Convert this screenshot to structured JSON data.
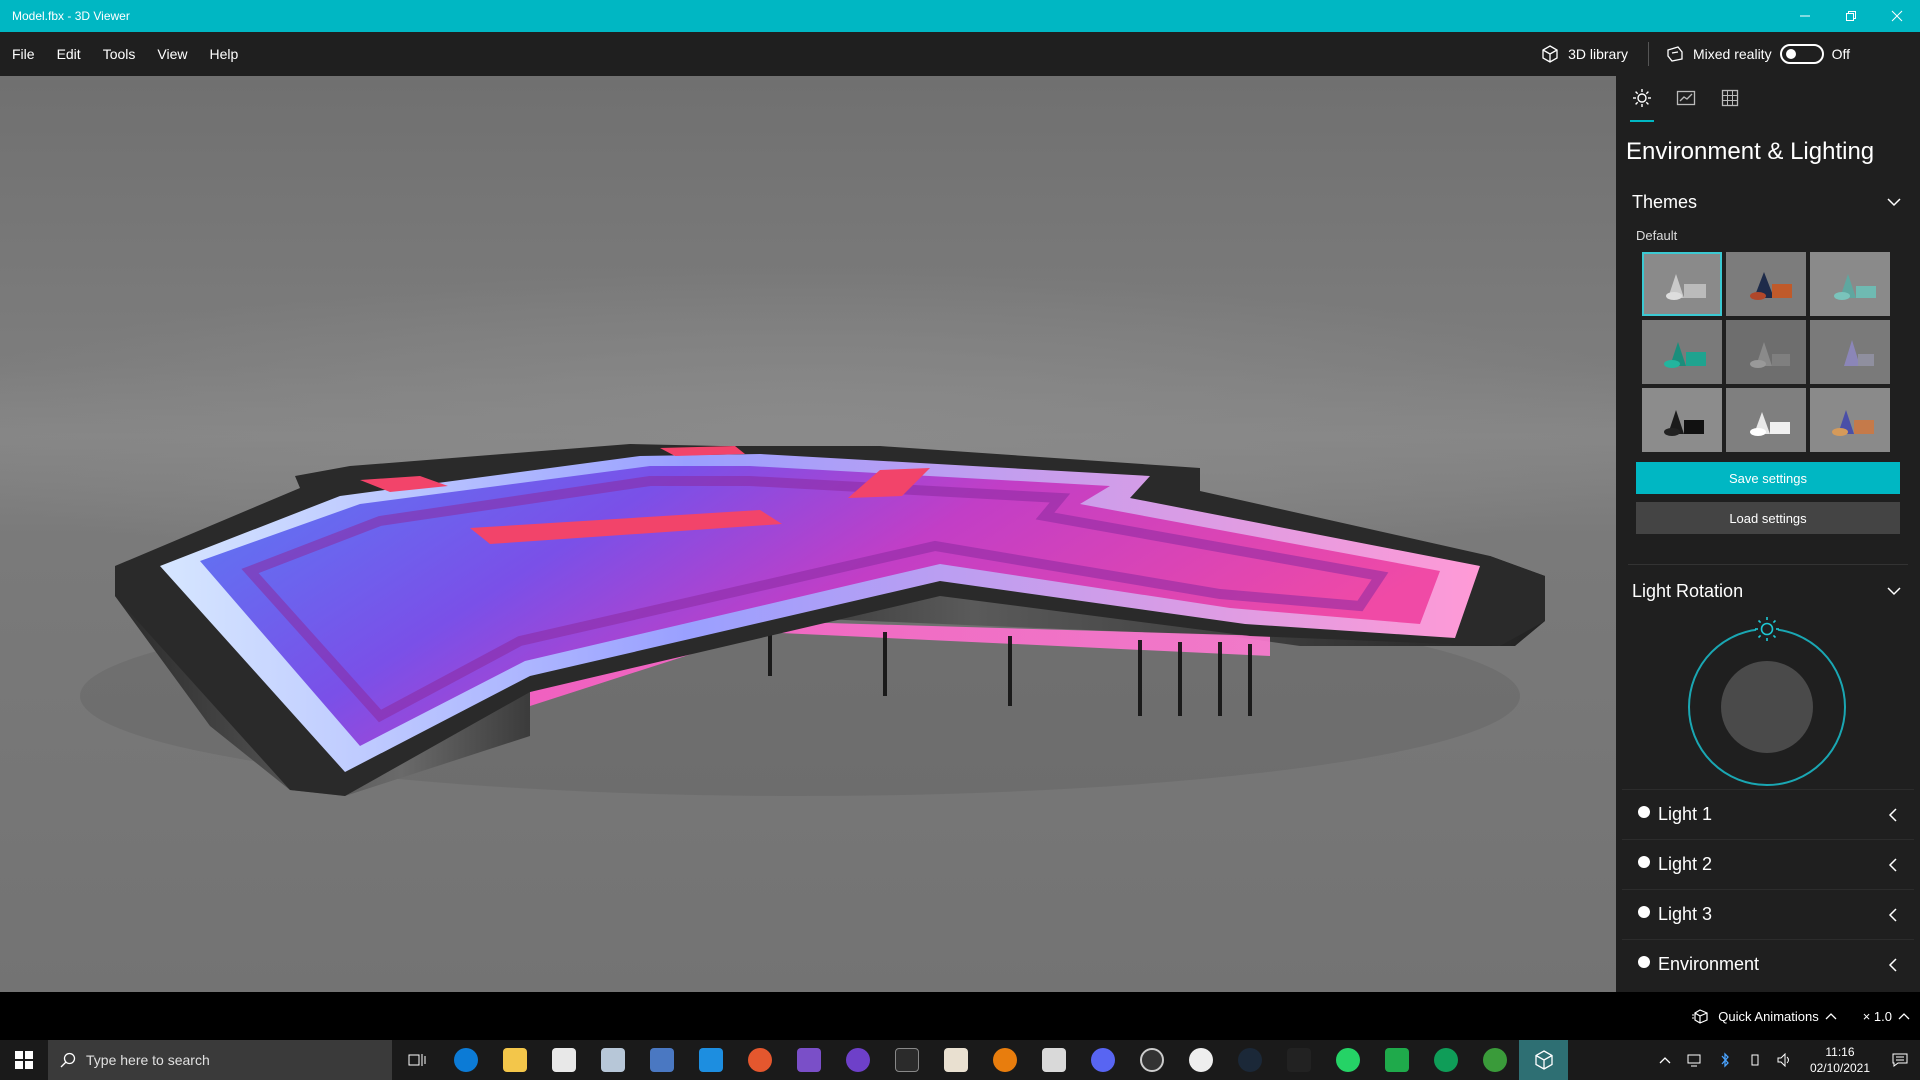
{
  "window": {
    "title": "Model.fbx - 3D Viewer"
  },
  "menu": {
    "items": [
      "File",
      "Edit",
      "Tools",
      "View",
      "Help"
    ],
    "library_label": "3D library",
    "mixed_reality_label": "Mixed reality",
    "mixed_reality_state": "Off"
  },
  "panel": {
    "title": "Environment & Lighting",
    "themes_label": "Themes",
    "default_label": "Default",
    "selected_theme_index": 0,
    "save_label": "Save settings",
    "load_label": "Load settings",
    "light_rotation_label": "Light Rotation",
    "lights": [
      "Light 1",
      "Light 2",
      "Light 3",
      "Environment"
    ]
  },
  "bottom": {
    "animations_label": "Quick Animations",
    "speed_label": "× 1.0"
  },
  "taskbar": {
    "search_placeholder": "Type here to search",
    "time": "11:16",
    "date": "02/10/2021"
  },
  "colors": {
    "accent": "#00b7c3",
    "panel_bg": "#1f1f1f",
    "menubar_bg": "#1f1f1f"
  }
}
